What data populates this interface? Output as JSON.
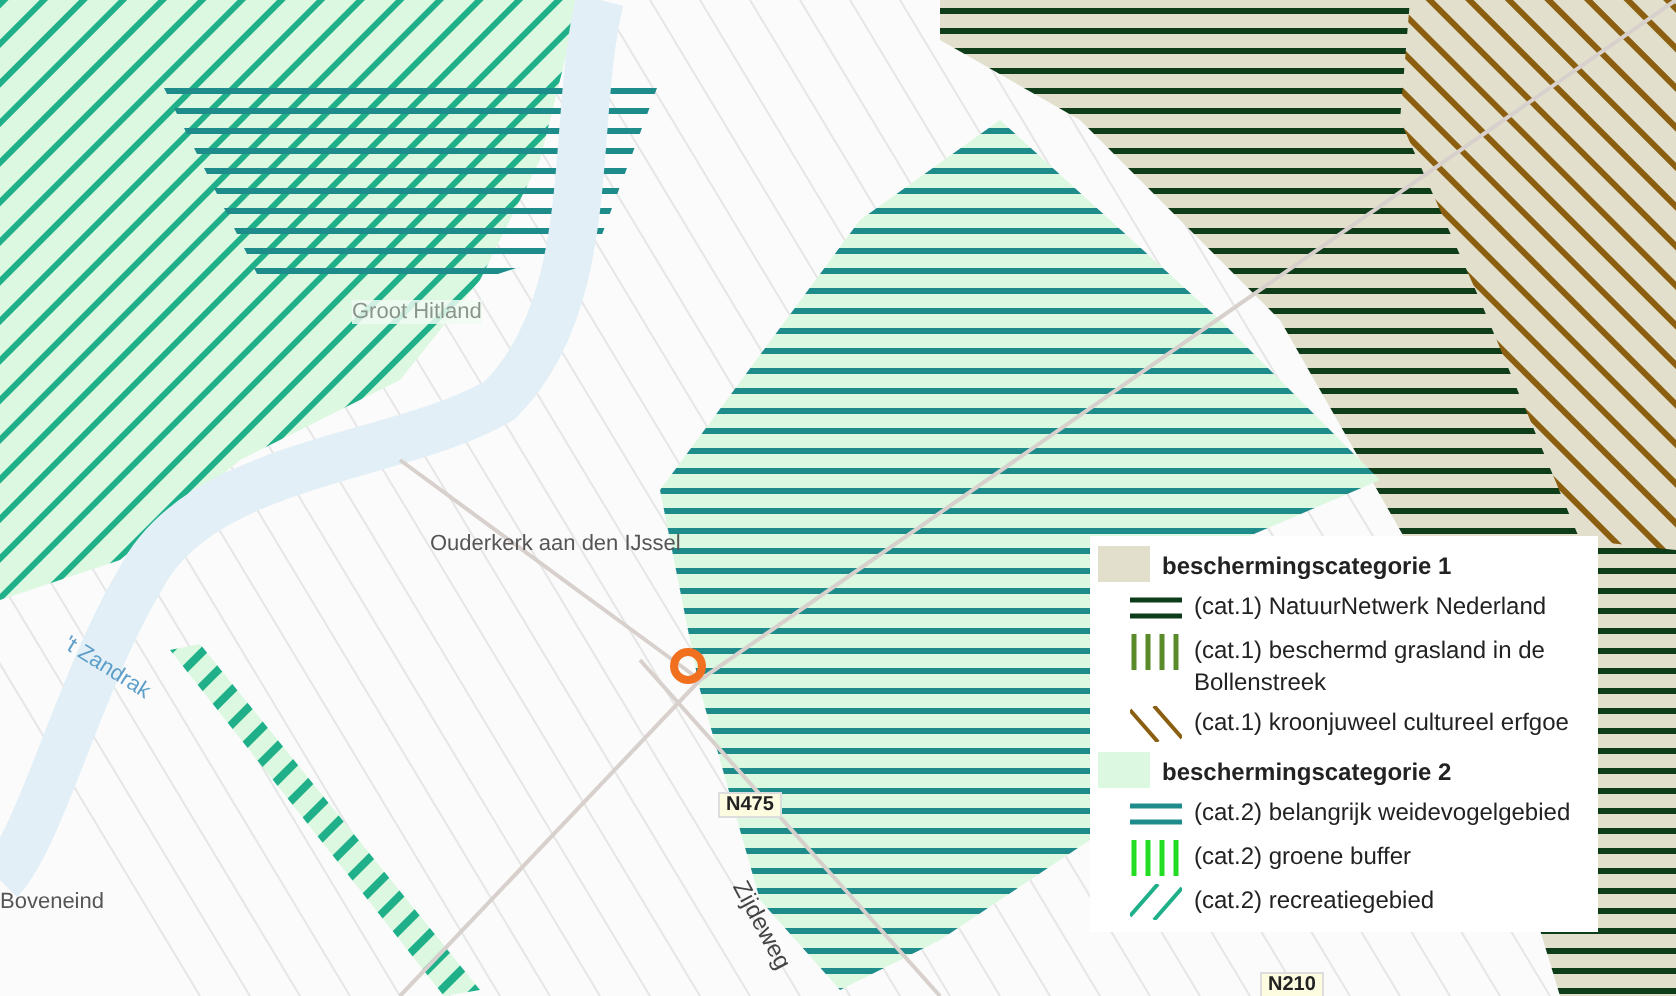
{
  "map": {
    "labels": [
      {
        "text": "Groot Hitland",
        "kind": "faded"
      },
      {
        "text": "Ouderkerk aan den IJssel",
        "kind": "place"
      },
      {
        "text": "'t Zandrak",
        "kind": "water"
      },
      {
        "text": "Boveneind",
        "kind": "place"
      },
      {
        "text": "N475",
        "kind": "road-number"
      },
      {
        "text": "Zijdeweg",
        "kind": "street"
      },
      {
        "text": "N210",
        "kind": "road-number"
      }
    ]
  },
  "legend": {
    "items": [
      {
        "label": "beschermingscategorie 1",
        "kind": "category",
        "color": "#e2e0cc"
      },
      {
        "label": "(cat.1) NatuurNetwerk Nederland",
        "kind": "horizontal",
        "color": "#0f3d1a"
      },
      {
        "label": "(cat.1) beschermd grasland in de Bollenstreek",
        "kind": "vertical",
        "color": "#5a8a2a"
      },
      {
        "label": "(cat.1) kroonjuweel cultureel erfgoe",
        "kind": "diagonal-down",
        "color": "#8b5e10"
      },
      {
        "label": "beschermingscategorie 2",
        "kind": "category",
        "color": "#dcf8e0"
      },
      {
        "label": "(cat.2) belangrijk weidevogelgebied",
        "kind": "horizontal",
        "color": "#1f8c8c"
      },
      {
        "label": "(cat.2) groene buffer",
        "kind": "vertical",
        "color": "#22dd22"
      },
      {
        "label": "(cat.2) recreatiegebied",
        "kind": "diagonal-up",
        "color": "#1fb08a"
      }
    ]
  }
}
